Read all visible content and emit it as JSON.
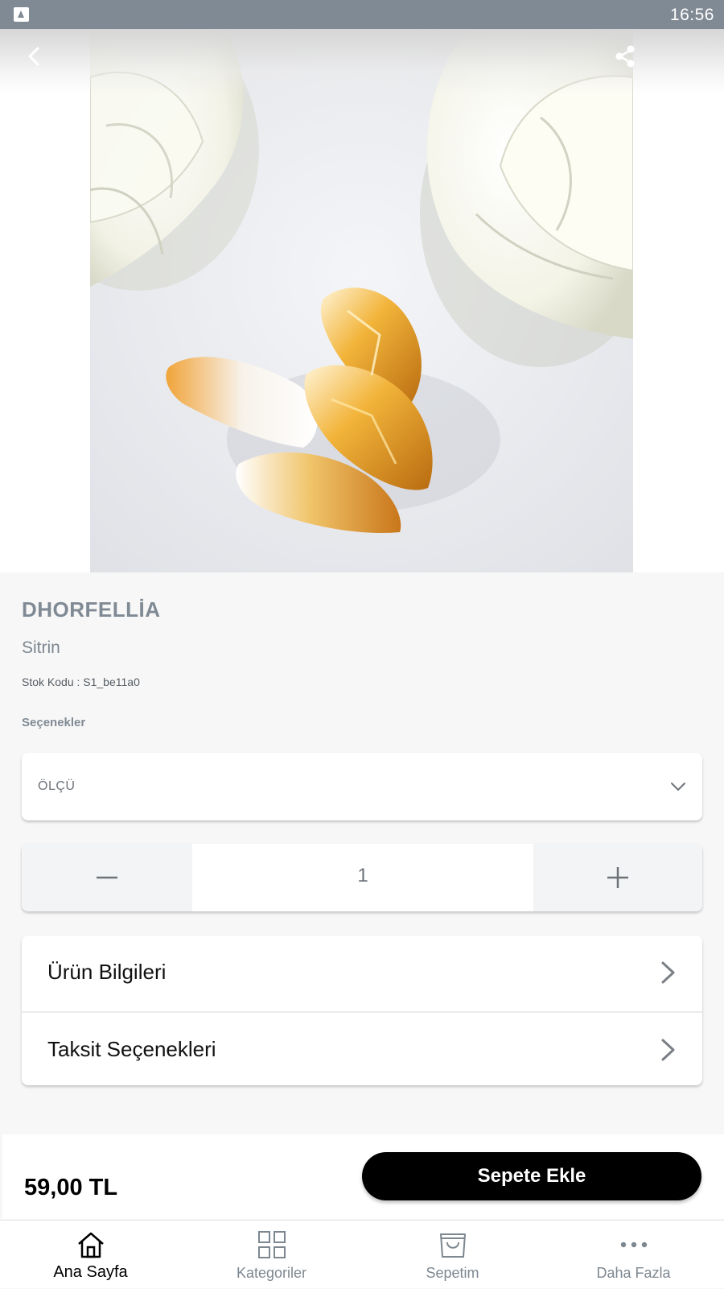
{
  "status_bar": {
    "time": "16:56"
  },
  "product": {
    "brand": "DHORFELLİA",
    "name": "Sitrin",
    "stock_code": "Stok Kodu : S1_be11a0",
    "options_title": "Seçenekler",
    "option_select": {
      "placeholder": "ÖLÇÜ"
    },
    "quantity": "1",
    "price": "59,00 TL"
  },
  "info_rows": [
    {
      "label": "Ürün Bilgileri"
    },
    {
      "label": "Taksit Seçenekleri"
    }
  ],
  "buy_bar": {
    "add_to_cart_label": "Sepete Ekle"
  },
  "tab_bar": {
    "tabs": [
      {
        "label": "Ana Sayfa",
        "icon": "home-icon",
        "active": true
      },
      {
        "label": "Kategoriler",
        "icon": "grid-icon",
        "active": false
      },
      {
        "label": "Sepetim",
        "icon": "bag-icon",
        "active": false
      },
      {
        "label": "Daha Fazla",
        "icon": "more-icon",
        "active": false
      }
    ]
  },
  "colors": {
    "status_bar": "#808a94",
    "brand_text": "#808a94",
    "primary_button": "#000000",
    "background": "#f7f7f7"
  }
}
